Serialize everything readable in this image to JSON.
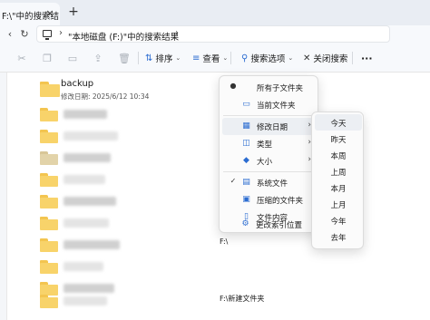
{
  "tab": {
    "title": "F:\\\"中的搜索结",
    "close": "×",
    "new": "+"
  },
  "nav": {
    "back": "‹",
    "refresh": "↻"
  },
  "address": {
    "sep1": "›",
    "text": "\"本地磁盘 (F:)\"中的搜索结果",
    "sep2": "›"
  },
  "toolbar": {
    "sort": {
      "icon": "⇅",
      "label": "排序",
      "caret": "⌄"
    },
    "view": {
      "icon": "≡",
      "label": "查看",
      "caret": "⌄"
    },
    "search_options": {
      "icon": "⚲",
      "label": "搜索选项",
      "caret": "⌄"
    },
    "close_search": {
      "icon": "✕",
      "label": "关闭搜索"
    },
    "more": "···",
    "disabled_icons": [
      "cut-icon",
      "copy-icon",
      "rename-icon",
      "share-icon",
      "delete-icon"
    ]
  },
  "files": {
    "backup": {
      "name": "backup",
      "modified": "修改日期: 2025/6/12 10:34"
    },
    "row_paths": [
      {
        "text": "F:\\"
      },
      {
        "text": "F:\\新建文件夹"
      }
    ]
  },
  "menu": {
    "items": [
      {
        "label": "所有子文件夹",
        "checked": true,
        "icon": ""
      },
      {
        "label": "当前文件夹",
        "checked": false,
        "icon": "folder-icon"
      },
      {
        "label": "修改日期",
        "checked": false,
        "icon": "calendar-icon",
        "submenu": true,
        "hover": true
      },
      {
        "label": "类型",
        "checked": false,
        "icon": "type-icon",
        "submenu": true
      },
      {
        "label": "大小",
        "checked": false,
        "icon": "size-icon",
        "submenu": true
      },
      {
        "label": "系统文件",
        "checked": true,
        "icon": "system-file-icon"
      },
      {
        "label": "压缩的文件夹",
        "checked": false,
        "icon": "zip-folder-icon"
      },
      {
        "label": "文件内容",
        "checked": false,
        "icon": "file-content-icon"
      },
      {
        "label": "更改索引位置",
        "checked": false,
        "icon": "index-icon"
      }
    ]
  },
  "submenu": {
    "items": [
      "今天",
      "昨天",
      "本周",
      "上周",
      "本月",
      "上月",
      "今年",
      "去年"
    ],
    "hover_index": 0
  },
  "colors": {
    "accent": "#2b6cd1",
    "folder": "#f8d36a",
    "tabstrip": "#e9edf3"
  }
}
